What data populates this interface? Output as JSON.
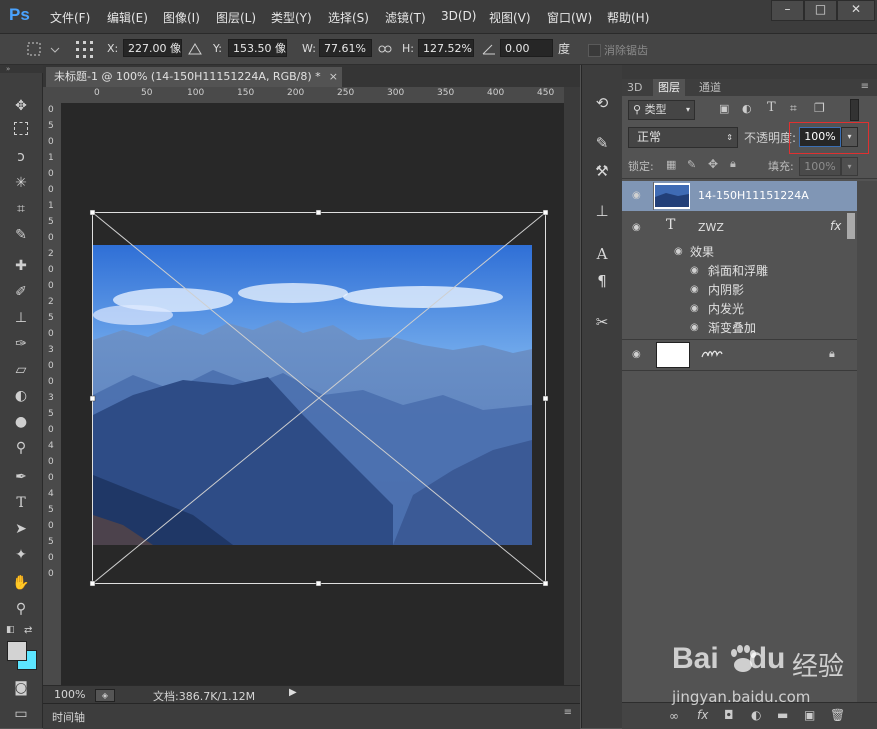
{
  "app": {
    "logo": "Ps",
    "brand_color": "#4aa3ff"
  },
  "menu": [
    "文件(F)",
    "编辑(E)",
    "图像(I)",
    "图层(L)",
    "类型(Y)",
    "选择(S)",
    "滤镜(T)",
    "3D(D)",
    "视图(V)",
    "窗口(W)",
    "帮助(H)"
  ],
  "window_controls": {
    "minimize": "–",
    "restore": "□",
    "close": "✕"
  },
  "options_bar": {
    "x_label": "X:",
    "x_value": "227.00 像",
    "y_label": "Y:",
    "y_value": "153.50 像",
    "w_label": "W:",
    "w_value": "77.61%",
    "h_label": "H:",
    "h_value": "127.52%",
    "angle_value": "0.00",
    "angle_unit": "度",
    "antialias_label": "消除锯齿"
  },
  "document": {
    "tab_title": "未标题-1 @ 100% (14-150H11151224A, RGB/8) *",
    "zoom": "100%",
    "doc_info": "文档:386.7K/1.12M",
    "timeline_label": "时间轴",
    "ruler_top": [
      "0",
      "50",
      "100",
      "150",
      "200",
      "250",
      "300",
      "350",
      "400",
      "450"
    ],
    "ruler_left": [
      "0",
      "5",
      "0",
      "1",
      "0",
      "0",
      "1",
      "5",
      "0",
      "2",
      "0",
      "0",
      "2",
      "5",
      "0",
      "3",
      "0",
      "0",
      "3",
      "5",
      "0",
      "4",
      "0",
      "0",
      "4",
      "5",
      "0",
      "5",
      "0",
      "0"
    ]
  },
  "layers_panel": {
    "tabs": [
      "3D",
      "图层",
      "通道"
    ],
    "active_tab": "图层",
    "filter_kind": "类型",
    "blend_mode": "正常",
    "opacity_label": "不透明度:",
    "opacity_value": "100%",
    "lock_label": "锁定:",
    "fill_label": "填充:",
    "fill_value": "100%",
    "layers": [
      {
        "name": "14-150H11151224A",
        "selected": true
      },
      {
        "name": "ZWZ",
        "type_icon": "T",
        "fx": "fx"
      },
      {
        "name": "",
        "locked": true
      }
    ],
    "effects_label": "效果",
    "effects": [
      "斜面和浮雕",
      "内阴影",
      "内发光",
      "渐变叠加"
    ]
  },
  "watermark": {
    "brand": "Bai",
    "brand2": "du",
    "sub": "经验",
    "url": "jingyan.baidu.com"
  }
}
